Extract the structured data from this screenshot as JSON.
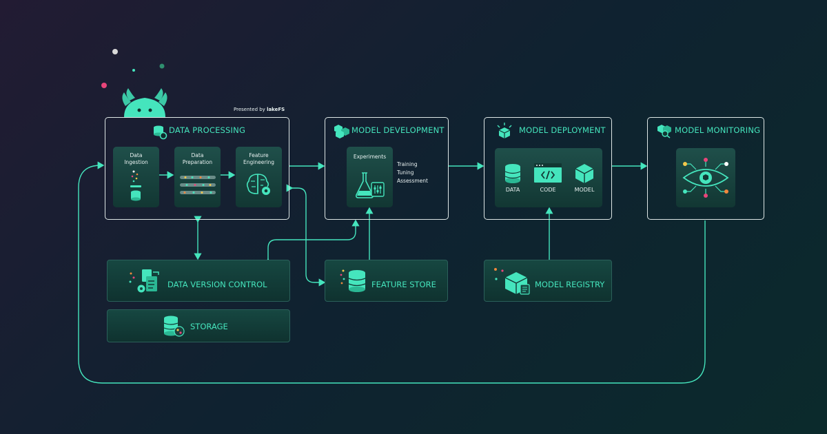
{
  "presented_by": "Presented by",
  "brand": "lakeFS",
  "stages": {
    "data_processing": {
      "title": "DATA PROCESSING",
      "tiles": [
        {
          "label": "Data Ingestion"
        },
        {
          "label": "Data Preparation"
        },
        {
          "label": "Feature Engineering"
        }
      ]
    },
    "model_development": {
      "title": "MODEL DEVELOPMENT",
      "experiments_label": "Experiments",
      "steps": [
        "Training",
        "Tuning",
        "Assessment"
      ]
    },
    "model_deployment": {
      "title": "MODEL DEPLOYMENT",
      "items": [
        "DATA",
        "CODE",
        "MODEL"
      ]
    },
    "model_monitoring": {
      "title": "MODEL MONITORING"
    }
  },
  "components": {
    "data_version_control": "DATA VERSION CONTROL",
    "storage": "STORAGE",
    "feature_store": "FEATURE STORE",
    "model_registry": "MODEL REGISTRY"
  },
  "colors": {
    "accent": "#45e5bd",
    "box_border": "#dfe8e7",
    "tile": "#1a4642",
    "dot_pink": "#e8457a",
    "dot_yellow": "#f3c84b",
    "dot_orange": "#f0873d"
  }
}
